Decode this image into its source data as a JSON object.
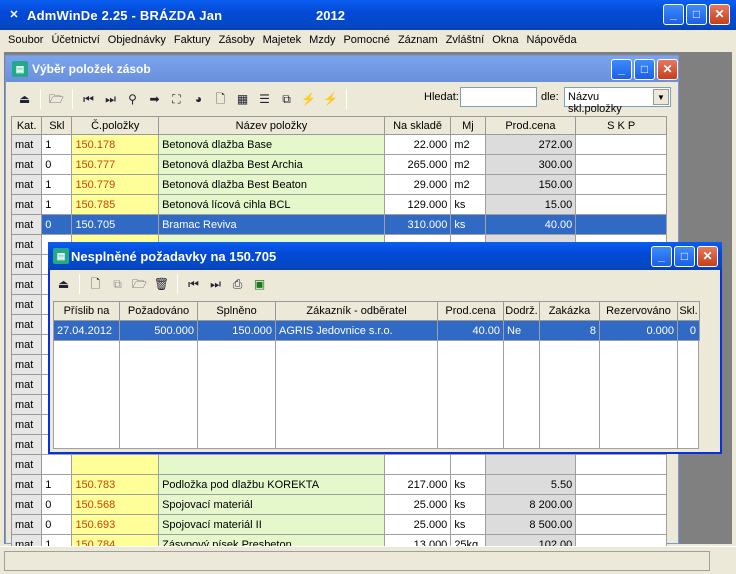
{
  "app": {
    "title": "AdmWinDe 2.25 - BRÁZDA Jan",
    "year": "2012"
  },
  "menu": [
    "Soubor",
    "Účetnictví",
    "Objednávky",
    "Faktury",
    "Zásoby",
    "Majetek",
    "Mzdy",
    "Pomocné",
    "Záznam",
    "Zvláštní",
    "Okna",
    "Nápověda"
  ],
  "win1": {
    "title": "Výběr položek zásob",
    "search_label": "Hledat:",
    "search_value": "",
    "by_label": "dle:",
    "by_value": "Názvu skl.položky",
    "columns": [
      "Kat.",
      "Skl",
      "Č.položky",
      "Název položky",
      "Na skladě",
      "Mj",
      "Prod.cena",
      "S K P"
    ],
    "rows": [
      [
        "mat",
        "1",
        "150.178",
        "Betonová dlažba Base",
        "22.000",
        "m2",
        "272.00",
        ""
      ],
      [
        "mat",
        "0",
        "150.777",
        "Betonová dlažba Best Archia",
        "265.000",
        "m2",
        "300.00",
        ""
      ],
      [
        "mat",
        "1",
        "150.779",
        "Betonová dlažba Best Beaton",
        "29.000",
        "m2",
        "150.00",
        ""
      ],
      [
        "mat",
        "1",
        "150.785",
        "Betonová lícová cihla BCL",
        "129.000",
        "ks",
        "15.00",
        ""
      ],
      [
        "mat",
        "0",
        "150.705",
        "Bramac Reviva",
        "310.000",
        "ks",
        "40.00",
        ""
      ],
      [
        "mat",
        "",
        "",
        "",
        "",
        "",
        "",
        ""
      ],
      [
        "mat",
        "",
        "",
        "",
        "",
        "",
        "",
        ""
      ],
      [
        "mat",
        "",
        "",
        "",
        "",
        "",
        "",
        ""
      ],
      [
        "mat",
        "",
        "",
        "",
        "",
        "",
        "",
        ""
      ],
      [
        "mat",
        "",
        "",
        "",
        "",
        "",
        "",
        ""
      ],
      [
        "mat",
        "",
        "",
        "",
        "",
        "",
        "",
        ""
      ],
      [
        "mat",
        "",
        "",
        "",
        "",
        "",
        "",
        ""
      ],
      [
        "mat",
        "",
        "",
        "",
        "",
        "",
        "",
        ""
      ],
      [
        "mat",
        "",
        "",
        "",
        "",
        "",
        "",
        ""
      ],
      [
        "mat",
        "",
        "",
        "",
        "",
        "",
        "",
        ""
      ],
      [
        "mat",
        "",
        "",
        "",
        "",
        "",
        "",
        ""
      ],
      [
        "mat",
        "",
        "",
        "",
        "",
        "",
        "",
        ""
      ],
      [
        "mat",
        "1",
        "150.783",
        "Podložka pod dlažbu KOREKTA",
        "217.000",
        "ks",
        "5.50",
        ""
      ],
      [
        "mat",
        "0",
        "150.568",
        "Spojovací materiál",
        "25.000",
        "ks",
        "8 200.00",
        ""
      ],
      [
        "mat",
        "0",
        "150.693",
        "Spojovací materiál II",
        "25.000",
        "ks",
        "8 500.00",
        ""
      ],
      [
        "mat",
        "1",
        "150.784",
        "Zásypový písek Presbeton",
        "13.000",
        "25kg",
        "102.00",
        ""
      ]
    ],
    "selected_row": 4
  },
  "win2": {
    "title": "Nesplněné požadavky na 150.705",
    "columns": [
      "Příslib na",
      "Požadováno",
      "Splněno",
      "Zákazník - odběratel",
      "Prod.cena",
      "Dodrž.",
      "Zakázka",
      "Rezervováno",
      "Skl."
    ],
    "rows": [
      [
        "27.04.2012",
        "500.000",
        "150.000",
        "AGRIS Jedovnice s.r.o.",
        "40.00",
        "Ne",
        "8",
        "0.000",
        "0"
      ]
    ]
  }
}
